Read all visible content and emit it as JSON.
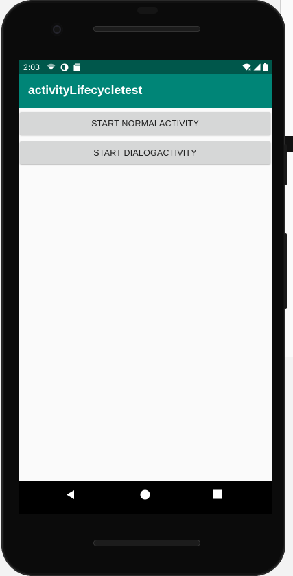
{
  "status_bar": {
    "time": "2:03"
  },
  "app_bar": {
    "title": "activityLifecycletest"
  },
  "buttons": {
    "start_normal_label": "START NORMALACTIVITY",
    "start_dialog_label": "START DIALOGACTIVITY"
  },
  "icons": {
    "status_left": [
      "wifi-question-icon",
      "data-saver-icon",
      "sd-card-icon"
    ],
    "status_right": [
      "wifi-icon",
      "signal-icon",
      "battery-icon"
    ],
    "nav": [
      "back-icon",
      "home-icon",
      "recents-icon"
    ]
  },
  "colors": {
    "status_bar": "#00574b",
    "app_bar": "#008577",
    "button_bg": "#d6d7d7",
    "screen_bg": "#fafafa"
  }
}
